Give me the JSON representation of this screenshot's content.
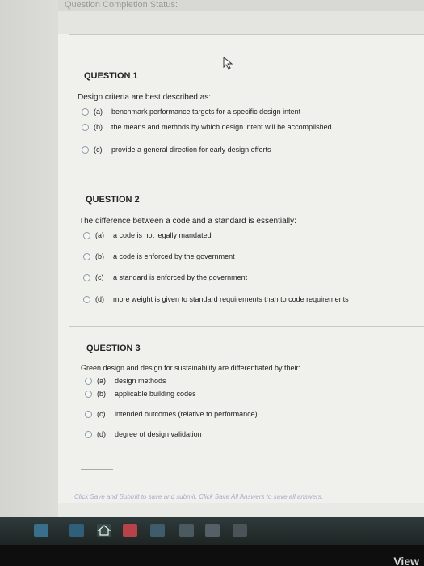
{
  "status_bar": {
    "label": "Question Completion Status:"
  },
  "questions": [
    {
      "title": "QUESTION 1",
      "prompt": "Design criteria are best described as:",
      "options": [
        {
          "letter": "(a)",
          "text": "benchmark performance targets for a specific design intent"
        },
        {
          "letter": "(b)",
          "text": "the means and methods by which design intent will be accomplished"
        },
        {
          "letter": "(c)",
          "text": "provide a general direction for early design efforts"
        }
      ]
    },
    {
      "title": "QUESTION 2",
      "prompt": "The difference between a code and a standard is essentially:",
      "options": [
        {
          "letter": "(a)",
          "text": "a code is not legally mandated"
        },
        {
          "letter": "(b)",
          "text": "a code is enforced by the government"
        },
        {
          "letter": "(c)",
          "text": "a standard is enforced by the government"
        },
        {
          "letter": "(d)",
          "text": "more weight is given to standard requirements than to code requirements"
        }
      ]
    },
    {
      "title": "QUESTION 3",
      "prompt": "Green design and design for sustainability are differentiated by their:",
      "options": [
        {
          "letter": "(a)",
          "text": "design methods"
        },
        {
          "letter": "(b)",
          "text": "applicable building codes"
        },
        {
          "letter": "(c)",
          "text": "intended outcomes (relative to performance)"
        },
        {
          "letter": "(d)",
          "text": "degree of design validation"
        }
      ]
    }
  ],
  "footer": {
    "note": "Click Save and Submit to save and submit. Click Save All Answers to save all answers."
  },
  "overlay": {
    "view_label": "View"
  },
  "colors": {
    "radio_border": "#8a9aa8",
    "footer_text": "#a9a9c9"
  }
}
